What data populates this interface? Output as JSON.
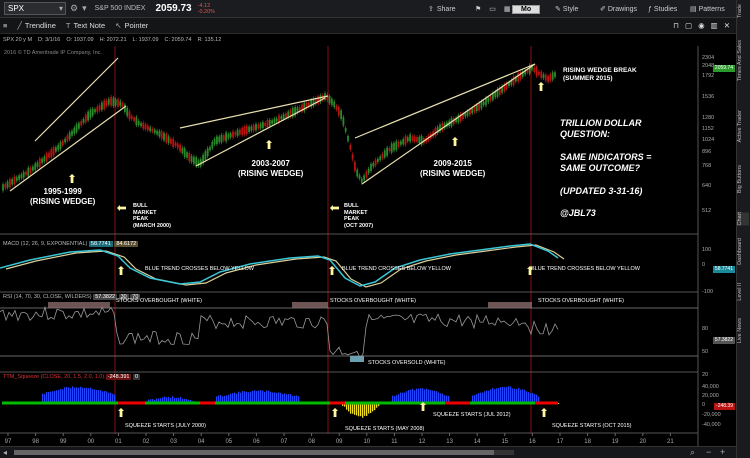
{
  "header": {
    "symbol": "SPX",
    "index_name": "S&P 500 INDEX",
    "last": "2059.73",
    "change": "-4.12",
    "change_pct": "-0.20%",
    "share": "Share",
    "period": "Mo",
    "style": "Style",
    "drawings": "Drawings",
    "studies": "Studies",
    "patterns": "Patterns"
  },
  "toolbar": {
    "trendline": "Trendline",
    "textnote": "Text Note",
    "pointer": "Pointer"
  },
  "info": {
    "symbol": "SPX 20 y M",
    "date": "D: 3/1/16",
    "open": "O: 1937.09",
    "high": "H: 2072.21",
    "low": "L: 1937.09",
    "close": "C: 2059.74",
    "range": "R: 135.12",
    "copyright": "2016 © TD Ameritrade IP Company, Inc."
  },
  "side_tabs": [
    "Trade",
    "Times And Sales",
    "Active Trader",
    "Big Buttons",
    "Chart",
    "Dashboard",
    "Level II",
    "Live News"
  ],
  "price_axis": [
    "2304",
    "2048",
    "1792",
    "1536",
    "1280",
    "1152",
    "1024",
    "896",
    "768",
    "640",
    "512"
  ],
  "last_badge": "2059.74",
  "annotations": {
    "a1": "1995-1999\n(RISING WEDGE)",
    "a2": "2003-2007\n(RISING WEDGE)",
    "a3": "2009-2015\n(RISING WEDGE)",
    "a4": "RISING WEDGE BREAK\n(SUMMER 2015)",
    "q": "TRILLION DOLLAR\nQUESTION:\n\nSAME INDICATORS =\nSAME OUTCOME?\n\n(UPDATED 3-31-16)\n\n@JBL73",
    "peak1": "BULL\nMARKET\nPEAK\n(MARCH 2000)",
    "peak2": "BULL\nMARKET\nPEAK\n(OCT 2007)"
  },
  "macd": {
    "label": "MACD (12, 26, 9, EXPONENTIAL)",
    "v1": "58.7741",
    "v2": "84.6172",
    "note": "BLUE TREND CROSSES BELOW YELLOW",
    "axis": [
      "100",
      "0",
      "-100"
    ],
    "badge": "58.7741"
  },
  "rsi": {
    "label": "RSI (14, 70, 30, CLOSE, WILDERS)",
    "v1": "57.3822",
    "v2": "30",
    "v3": "70",
    "ob": "STOCKS OVERBOUGHT (WHITE)",
    "os": "STOCKS OVERSOLD (WHITE)",
    "axis": [
      "80",
      "50",
      "20"
    ],
    "badge": "57.3822"
  },
  "squeeze": {
    "label": "TTM_Squeeze (CLOSE, 20, 1.5, 2.0, 1.0)",
    "v1": "-248.391",
    "v2": "0",
    "n1": "SQUEEZE STARTS (JULY 2000)",
    "n2": "SQUEEZE STARTS (MAY 2008)",
    "n3": "SQUEEZE STARTS (JUL 2012)",
    "n4": "SQUEEZE STARTS (OCT 2015)",
    "axis": [
      "40,000",
      "20,000",
      "0",
      "-20,000",
      "-40,000"
    ],
    "badge": "-248.39"
  },
  "x_axis": [
    "97",
    "98",
    "99",
    "00",
    "01",
    "02",
    "03",
    "04",
    "05",
    "06",
    "07",
    "08",
    "09",
    "10",
    "11",
    "12",
    "13",
    "14",
    "15",
    "16",
    "17",
    "18",
    "19",
    "20",
    "21"
  ],
  "colors": {
    "macd_fast": "#39c6d8",
    "macd_slow": "#d9cf99",
    "up": "#2a8a2a",
    "down": "#b11",
    "squeeze_pos": "#2244ff",
    "squeeze_neg": "#f0e020",
    "dot_red": "#e00",
    "dot_green": "#0b0"
  }
}
